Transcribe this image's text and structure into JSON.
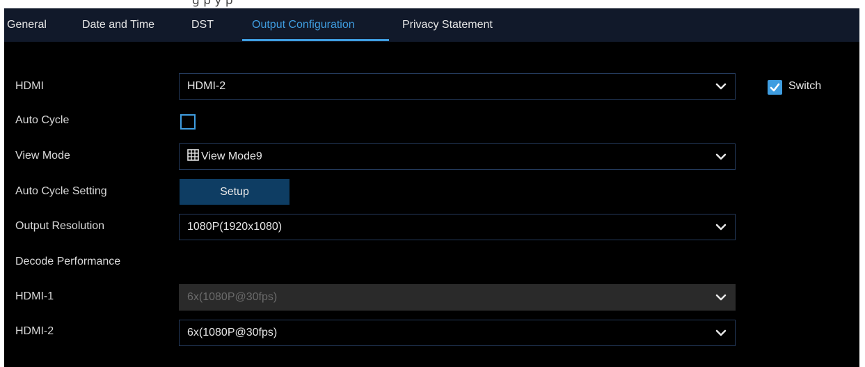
{
  "header_fragment": "g                  p   y    p",
  "tabs": [
    {
      "label": "General"
    },
    {
      "label": "Date and Time"
    },
    {
      "label": "DST"
    },
    {
      "label": "Output Configuration",
      "active": true
    },
    {
      "label": "Privacy Statement"
    }
  ],
  "form": {
    "hdmi": {
      "label": "HDMI",
      "value": "HDMI-2"
    },
    "switch": {
      "label": "Switch",
      "checked": true
    },
    "auto_cycle": {
      "label": "Auto Cycle",
      "checked": false
    },
    "view_mode": {
      "label": "View Mode",
      "value": "View Mode9",
      "icon": "grid-icon"
    },
    "auto_cycle_setting": {
      "label": "Auto Cycle Setting",
      "button": "Setup"
    },
    "output_resolution": {
      "label": "Output Resolution",
      "value": "1080P(1920x1080)"
    },
    "decode_performance": {
      "label": "Decode Performance"
    },
    "hdmi1": {
      "label": "HDMI-1",
      "value": "6x(1080P@30fps)",
      "disabled": true
    },
    "hdmi2": {
      "label": "HDMI-2",
      "value": "6x(1080P@30fps)"
    }
  },
  "colors": {
    "accent": "#3f9de0",
    "tabbar_bg": "#11192a",
    "panel_bg": "#000000",
    "button_bg": "#0e3d63",
    "disabled_bg": "#2a2a2a"
  }
}
